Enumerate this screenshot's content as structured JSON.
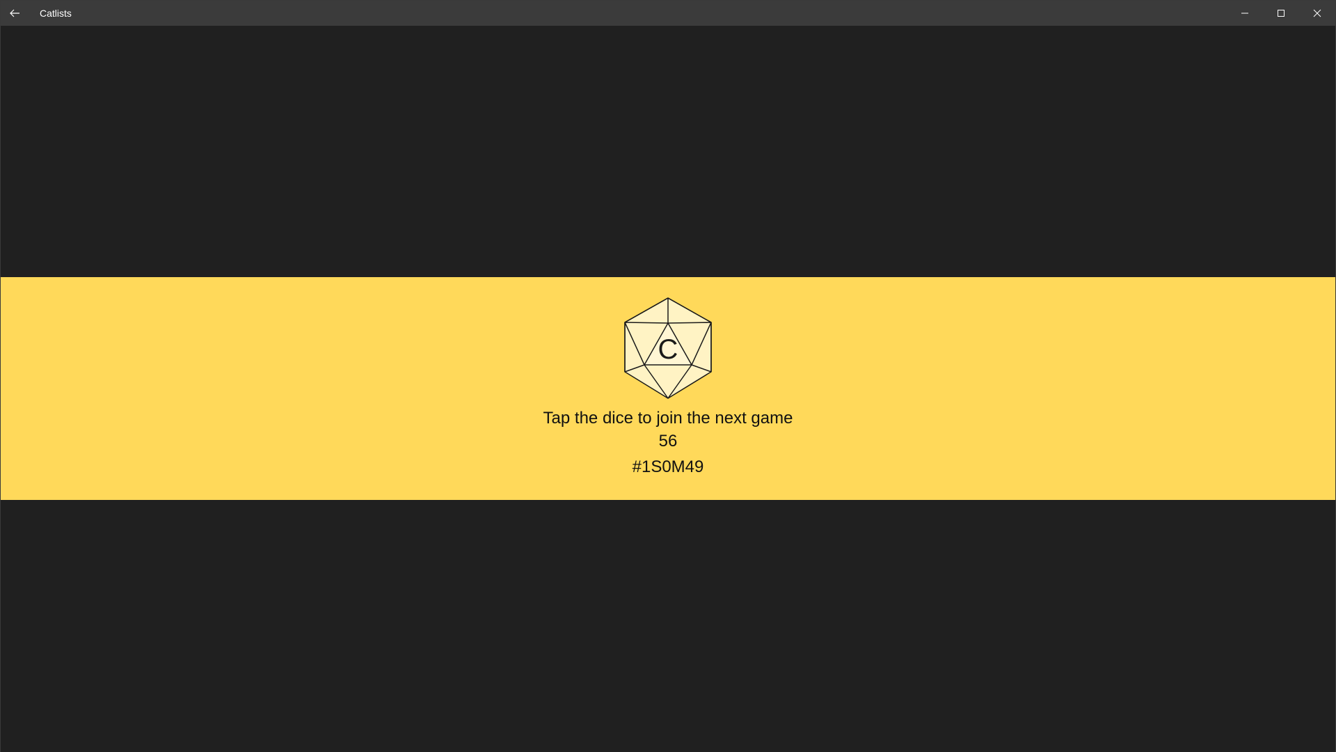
{
  "window": {
    "title": "Catlists",
    "back_icon": "back-arrow-icon",
    "minimize_icon": "minimize-icon",
    "maximize_icon": "maximize-icon",
    "close_icon": "close-icon"
  },
  "colors": {
    "background": "#202020",
    "titlebar": "#3b3b3b",
    "banner": "#ffd95a",
    "dice_face": "#fff3c4",
    "text": "#111111"
  },
  "banner": {
    "dice_letter": "C",
    "prompt": "Tap the dice to join the next game",
    "count": "56",
    "game_id": "#1S0M49"
  }
}
